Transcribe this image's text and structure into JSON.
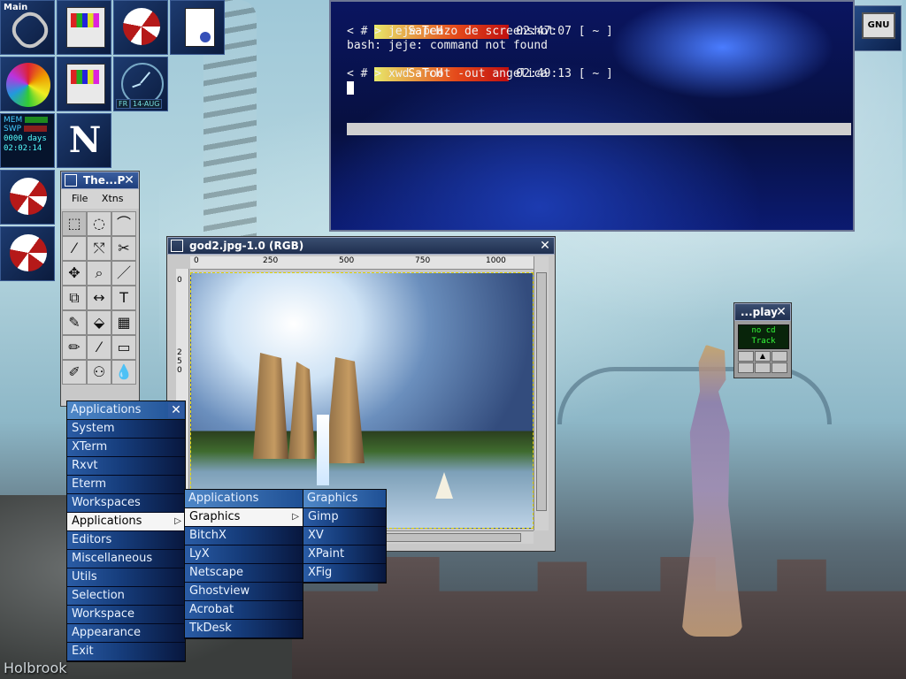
{
  "dock": {
    "main_label": "Main",
    "clock_day": "FR",
    "clock_date": "14-AUG",
    "sysmon": {
      "mem_label": "MEM",
      "swp_label": "SWP",
      "uptime_days": "0000 days",
      "uptime_time": "02:02:14"
    }
  },
  "terminal": {
    "prompt_user": "SaTcH",
    "lines": [
      {
        "time": "02:47:07 [ ~ ]"
      },
      {
        "text": "< # > jeje peazo de screenshot"
      },
      {
        "text": "bash: jeje: command not found"
      },
      {
        "time": "02:49:13 [ ~ ]"
      },
      {
        "text": "< # > xwd -root -out angelica"
      }
    ]
  },
  "gnu_label": "GNU",
  "toolbox": {
    "title": "The...P",
    "menu": [
      "File",
      "Xtns"
    ],
    "tools": [
      "⬚",
      "◌",
      "⌒",
      "⁄",
      "⤲",
      "✂",
      "✥",
      "⌕",
      "／",
      "⧉",
      "↔",
      "T",
      "✎",
      "⬙",
      "▦",
      "✏",
      "⁄",
      "▭",
      "✐",
      "⚇",
      "💧"
    ]
  },
  "image_window": {
    "title": "god2.jpg-1.0 (RGB)",
    "ruler_top": [
      "0",
      "250",
      "500",
      "750",
      "1000"
    ],
    "ruler_left": [
      "0",
      "2",
      "5",
      "0"
    ]
  },
  "cd_player": {
    "title": "...play",
    "display_line1": "no cd",
    "display_line2": "Track",
    "buttons": [
      "",
      "▲",
      "",
      "",
      "",
      ""
    ]
  },
  "menus": {
    "root": {
      "title": "Applications",
      "items": [
        "System",
        "XTerm",
        "Rxvt",
        "Eterm",
        "Workspaces",
        "Applications",
        "Editors",
        "Miscellaneous",
        "Utils",
        "Selection",
        "Workspace",
        "Appearance",
        "Exit"
      ]
    },
    "applications": {
      "title": "Applications",
      "items": [
        "Graphics",
        "BitchX",
        "LyX",
        "Netscape",
        "Ghostview",
        "Acrobat",
        "TkDesk"
      ]
    },
    "graphics": {
      "title": "Graphics",
      "items": [
        "Gimp",
        "XV",
        "XPaint",
        "XFig"
      ]
    }
  },
  "signature": "Holbrook"
}
